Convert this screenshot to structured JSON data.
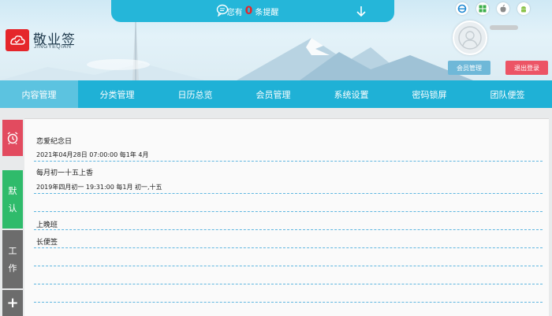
{
  "header": {
    "logo_title": "敬业签",
    "logo_sub": "JINGYEQIAN",
    "notice_prefix": "您有",
    "notice_count": "0",
    "notice_suffix": "条提醒",
    "member_button": "会员管理",
    "logout_button": "退出登录"
  },
  "nav": {
    "items": [
      "内容管理",
      "分类管理",
      "日历总览",
      "会员管理",
      "系统设置",
      "密码锁屏",
      "团队便签"
    ]
  },
  "sidebar": {
    "default_label_1": "默",
    "default_label_2": "认",
    "work_label_1": "工",
    "work_label_2": "作",
    "add_label": "+"
  },
  "content": {
    "note1_title": "恋爱纪念日",
    "note1_meta": "2021年04月28日 07:00:00 每1年 4月",
    "note2_title": "每月初一十五上香",
    "note2_meta": "2019年四月初一 19:31:00 每1月 初一,十五",
    "note3_title": "上晚班",
    "note4_title": "长便签"
  },
  "colors": {
    "nav": "#1fb1d6",
    "nav_active": "#5cc3e0",
    "alarm": "#e24b5f",
    "default": "#2fbb6b",
    "work": "#6c6c6c",
    "logout": "#ec5465",
    "logo": "#e5262b"
  }
}
